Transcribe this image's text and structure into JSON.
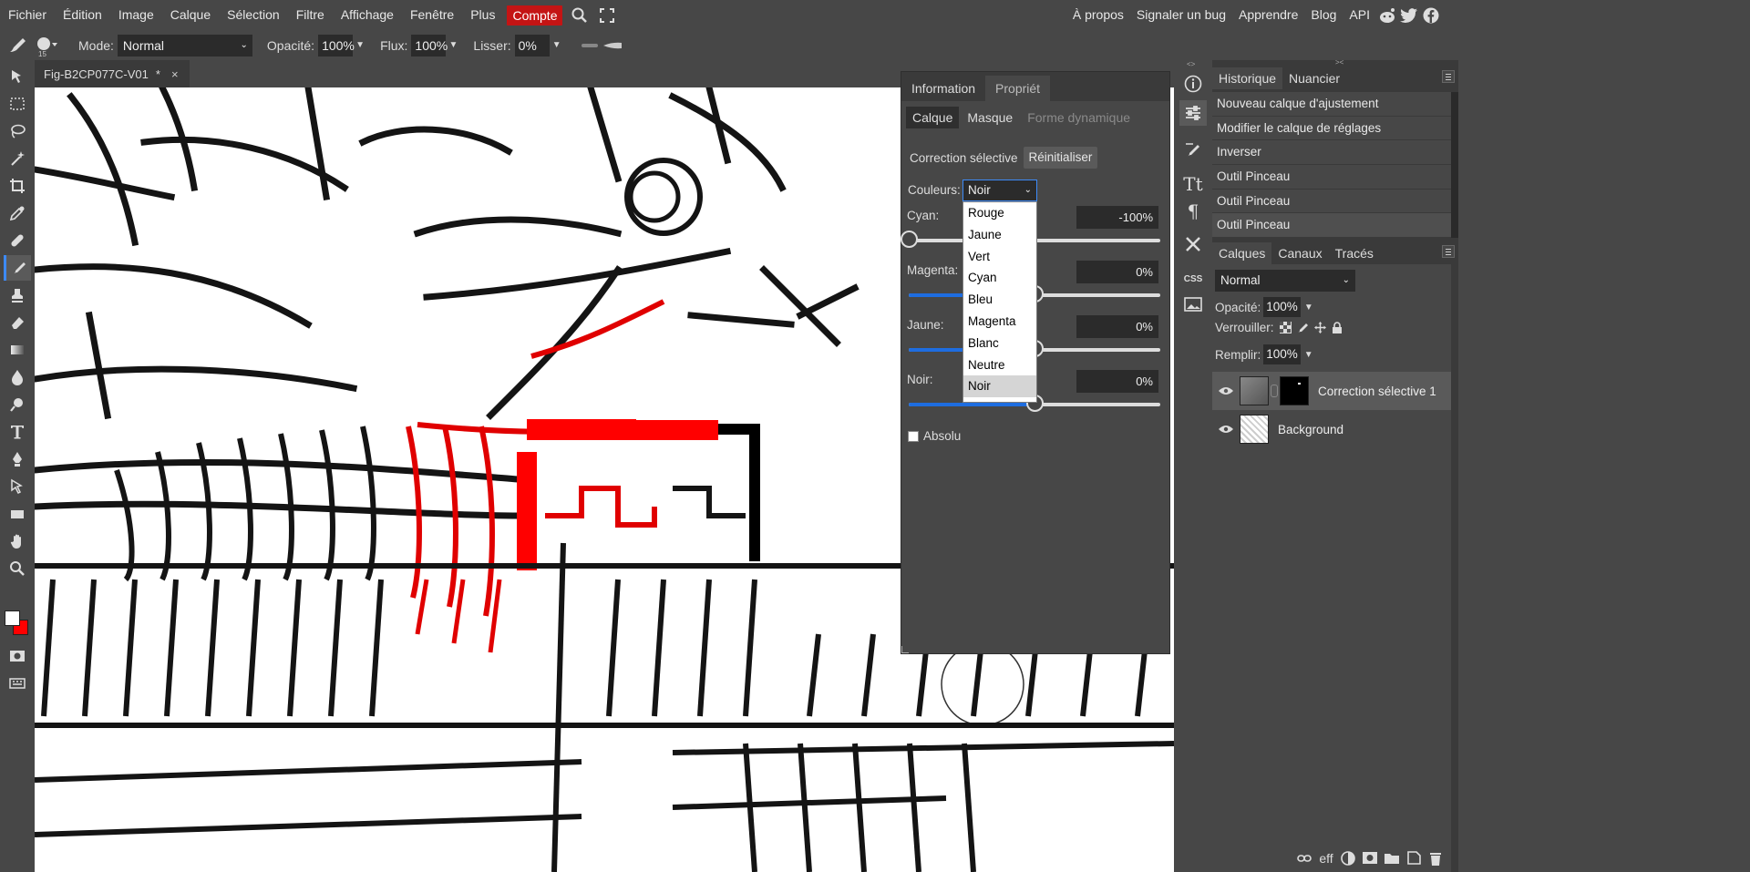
{
  "menubar": {
    "items": [
      "Fichier",
      "Édition",
      "Image",
      "Calque",
      "Sélection",
      "Filtre",
      "Affichage",
      "Fenêtre",
      "Plus"
    ],
    "account": "Compte",
    "right_links": [
      "À propos",
      "Signaler un bug",
      "Apprendre",
      "Blog",
      "API"
    ],
    "social_icons": [
      "reddit-icon",
      "twitter-icon",
      "facebook-icon"
    ]
  },
  "options": {
    "brush_size": "15",
    "mode_label": "Mode:",
    "mode_value": "Normal",
    "opacity_label": "Opacité:",
    "opacity_value": "100%",
    "flow_label": "Flux:",
    "flow_value": "100%",
    "smooth_label": "Lisser:",
    "smooth_value": "0%"
  },
  "document": {
    "tab_title": "Fig-B2CP077C-V01",
    "modified_mark": "*",
    "close": "×"
  },
  "properties": {
    "tabs": [
      "Information",
      "Propriét"
    ],
    "subtabs": [
      "Calque",
      "Masque",
      "Forme dynamique"
    ],
    "adjustment_name": "Correction sélective",
    "reset_button": "Réinitialiser",
    "colors_label": "Couleurs:",
    "colors_value": "Noir",
    "sliders": [
      {
        "label": "Cyan:",
        "value": "-100%",
        "level": 0.0
      },
      {
        "label": "Magenta:",
        "value": "0%",
        "level": 0.5
      },
      {
        "label": "Jaune:",
        "value": "0%",
        "level": 0.5
      },
      {
        "label": "Noir:",
        "value": "0%",
        "level": 0.5
      }
    ],
    "absolute_label": "Absolu",
    "dropdown_options": [
      "Rouge",
      "Jaune",
      "Vert",
      "Cyan",
      "Bleu",
      "Magenta",
      "Blanc",
      "Neutre",
      "Noir"
    ],
    "dropdown_selected": "Noir"
  },
  "history": {
    "tabs": [
      "Historique",
      "Nuancier"
    ],
    "items": [
      "Nouveau calque d'ajustement",
      "Modifier le calque de réglages",
      "Inverser",
      "Outil Pinceau",
      "Outil Pinceau",
      "Outil Pinceau"
    ]
  },
  "layers": {
    "tabs": [
      "Calques",
      "Canaux",
      "Tracés"
    ],
    "blend_mode": "Normal",
    "opacity_label": "Opacité:",
    "opacity_value": "100%",
    "lock_label": "Verrouiller:",
    "fill_label": "Remplir:",
    "fill_value": "100%",
    "items": [
      {
        "name": "Correction sélective 1",
        "selected": true
      },
      {
        "name": "Background",
        "selected": false
      }
    ],
    "footer_icons": [
      "link-icon",
      "effects-icon",
      "adjustment-icon",
      "mask-icon",
      "folder-icon",
      "new-layer-icon",
      "trash-icon"
    ],
    "footer_eff": "eff"
  },
  "colors": {
    "accent": "#c41414",
    "highlight": "#3d8af7",
    "slider_fill": "#1e6de0",
    "foreground": "#ffffff",
    "background": "#ff0000"
  }
}
